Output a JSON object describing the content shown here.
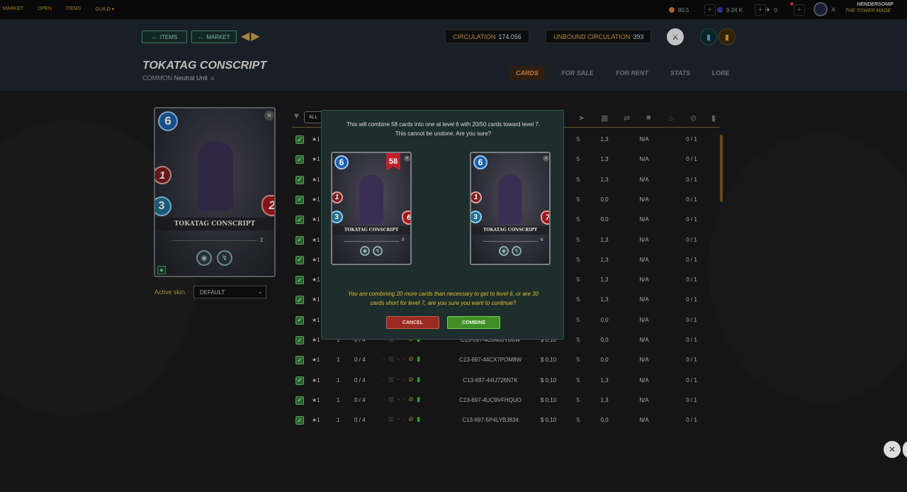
{
  "topbar": {
    "nav": [
      "MARKET",
      "OPEN",
      "ITEMS",
      "GUILD ▾"
    ],
    "dec": "80.5",
    "sps": "9.24 K",
    "vouchers": "0",
    "username": "HENDERSONIP",
    "user_title": "THE TOWER MAGE"
  },
  "header": {
    "back_items": "ITEMS",
    "back_market": "MARKET",
    "circulation_label": "CIRCULATION",
    "circulation_value": "174.056",
    "unbound_label": "UNBOUND CIRCULATION",
    "unbound_value": "393",
    "card_name": "TOKATAG CONSCRIPT",
    "rarity": "COMMON",
    "element": "Neutral",
    "type": "Unit",
    "tabs": [
      "CARDS",
      "FOR SALE",
      "FOR RENT",
      "STATS",
      "LORE"
    ],
    "active_tab": "CARDS"
  },
  "preview": {
    "mana": "6",
    "attack": "1",
    "speed": "3",
    "health": "2",
    "name": "TOKATAG CONSCRIPT",
    "level": "1",
    "skin_label": "Active skin",
    "skin_value": "DEFAULT"
  },
  "table": {
    "all_label": "ALL",
    "rows": [
      {
        "stars": "★1",
        "lvl": "",
        "bcx": "",
        "uid": "",
        "price": "",
        "col5": "5",
        "col6": "1,3",
        "col7": "N/A",
        "col8": "0 / 1"
      },
      {
        "stars": "★1",
        "lvl": "",
        "bcx": "",
        "uid": "",
        "price": "",
        "col5": "5",
        "col6": "1,3",
        "col7": "N/A",
        "col8": "0 / 1"
      },
      {
        "stars": "★1",
        "lvl": "",
        "bcx": "",
        "uid": "",
        "price": "",
        "col5": "5",
        "col6": "1,3",
        "col7": "N/A",
        "col8": "0 / 1"
      },
      {
        "stars": "★1",
        "lvl": "",
        "bcx": "",
        "uid": "",
        "price": "",
        "col5": "5",
        "col6": "0,0",
        "col7": "N/A",
        "col8": "0 / 1"
      },
      {
        "stars": "★1",
        "lvl": "",
        "bcx": "",
        "uid": "",
        "price": "",
        "col5": "5",
        "col6": "0,0",
        "col7": "N/A",
        "col8": "0 / 1"
      },
      {
        "stars": "★1",
        "lvl": "",
        "bcx": "",
        "uid": "",
        "price": "",
        "col5": "5",
        "col6": "1,3",
        "col7": "N/A",
        "col8": "0 / 1"
      },
      {
        "stars": "★1",
        "lvl": "",
        "bcx": "",
        "uid": "",
        "price": "",
        "col5": "5",
        "col6": "1,3",
        "col7": "N/A",
        "col8": "0 / 1"
      },
      {
        "stars": "★1",
        "lvl": "",
        "bcx": "",
        "uid": "",
        "price": "",
        "col5": "5",
        "col6": "1,3",
        "col7": "N/A",
        "col8": "0 / 1"
      },
      {
        "stars": "★1",
        "lvl": "",
        "bcx": "",
        "uid": "",
        "price": "",
        "col5": "5",
        "col6": "1,3",
        "col7": "N/A",
        "col8": "0 / 1"
      },
      {
        "stars": "★1",
        "lvl": "",
        "bcx": "",
        "uid": "",
        "price": "",
        "col5": "5",
        "col6": "0,0",
        "col7": "N/A",
        "col8": "0 / 1"
      },
      {
        "stars": "★1",
        "lvl": "1",
        "bcx": "0 / 4",
        "uid": "C13-697-4O5460YB8W",
        "price": "$ 0,10",
        "col5": "5",
        "col6": "0,0",
        "col7": "N/A",
        "col8": "0 / 1"
      },
      {
        "stars": "★1",
        "lvl": "1",
        "bcx": "0 / 4",
        "uid": "C13-697-44CX7POM8W",
        "price": "$ 0,10",
        "col5": "5",
        "col6": "0,0",
        "col7": "N/A",
        "col8": "0 / 1"
      },
      {
        "stars": "★1",
        "lvl": "1",
        "bcx": "0 / 4",
        "uid": "C13-697-44IJ726N7K",
        "price": "$ 0,10",
        "col5": "5",
        "col6": "1,3",
        "col7": "N/A",
        "col8": "0 / 1"
      },
      {
        "stars": "★1",
        "lvl": "1",
        "bcx": "0 / 4",
        "uid": "C13-697-4UC9VFHQUO",
        "price": "$ 0,10",
        "col5": "5",
        "col6": "1,3",
        "col7": "N/A",
        "col8": "0 / 1"
      },
      {
        "stars": "★1",
        "lvl": "1",
        "bcx": "0 / 4",
        "uid": "C13-697-5P4LYBJ834",
        "price": "$ 0,10",
        "col5": "5",
        "col6": "0,0",
        "col7": "N/A",
        "col8": "0 / 1"
      }
    ]
  },
  "modal": {
    "message_line1": "This will combine 58 cards into one at level 6 with 20/50 cards toward level 7.",
    "message_line2": "This cannot be undone. Are you sure?",
    "card_left": {
      "mana": "6",
      "attack": "1",
      "speed": "3",
      "health": "6",
      "name": "TOKATAG CONSCRIPT",
      "level": "5",
      "count": "58"
    },
    "card_right": {
      "mana": "6",
      "attack": "1",
      "speed": "3",
      "health": "7",
      "name": "TOKATAG CONSCRIPT",
      "level": "6"
    },
    "warning_line1": "You are combining 20 more cards than necessary to get to level 6, or are 30",
    "warning_line2": "cards short for level 7, are you sure you want to continue?",
    "cancel_label": "CANCEL",
    "combine_label": "COMBINE"
  },
  "colors": {
    "accent_gold": "#c9a24a",
    "tab_active": "#e59a4b",
    "combine_green": "#3f8f26",
    "cancel_red": "#9a2a22",
    "warning_yellow": "#e0c030"
  }
}
